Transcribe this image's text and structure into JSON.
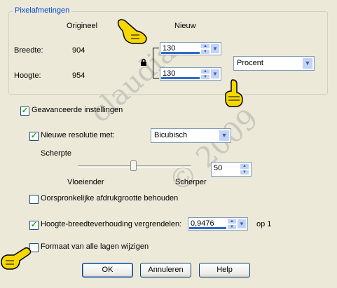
{
  "pixel_group": {
    "legend": "Pixelafmetingen",
    "col_original": "Origineel",
    "col_new": "Nieuw",
    "width_label": "Breedte:",
    "width_original": "904",
    "width_new": "130",
    "height_label": "Hoogte:",
    "height_original": "954",
    "height_new": "130",
    "unit": "Procent"
  },
  "advanced": {
    "label": "Geavanceerde instellingen",
    "checked": true
  },
  "resolution": {
    "label": "Nieuwe resolutie met:",
    "checked": true,
    "method": "Bicubisch"
  },
  "sharpness": {
    "label": "Scherpte",
    "min_label": "Vloeiender",
    "max_label": "Scherper",
    "value": "50"
  },
  "keep_print_size": {
    "label": "Oorspronkelijke afdrukgrootte behouden",
    "checked": false
  },
  "lock_ratio": {
    "label": "Hoogte-breedteverhouding vergrendelen:",
    "checked": true,
    "value": "0,9476",
    "suffix": "op 1"
  },
  "all_layers": {
    "label": "Formaat van alle lagen wijzigen",
    "checked": false
  },
  "buttons": {
    "ok": "OK",
    "cancel": "Annuleren",
    "help": "Help"
  },
  "watermark": {
    "text1": "claudia",
    "text2": "© 2009"
  },
  "colors": {
    "legend_blue": "#0046d5",
    "dialog_bg": "#ece9d8",
    "hand_yellow": "#f5d800"
  }
}
